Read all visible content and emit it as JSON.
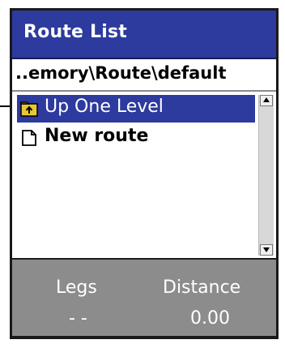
{
  "window": {
    "title": "Route List"
  },
  "path": {
    "text": "..emory\\Route\\default"
  },
  "list": {
    "items": [
      {
        "label": "Up One Level",
        "icon": "folder-up-icon",
        "selected": true
      },
      {
        "label": "New route",
        "icon": "document-icon",
        "selected": false
      }
    ]
  },
  "status": {
    "legs_label": "Legs",
    "legs_value": "- -",
    "distance_label": "Distance",
    "distance_value": "0.00"
  },
  "colors": {
    "title_bg": "#2d3a9e",
    "selection_bg": "#2d3a9e",
    "status_bg": "#8c8c8c"
  }
}
